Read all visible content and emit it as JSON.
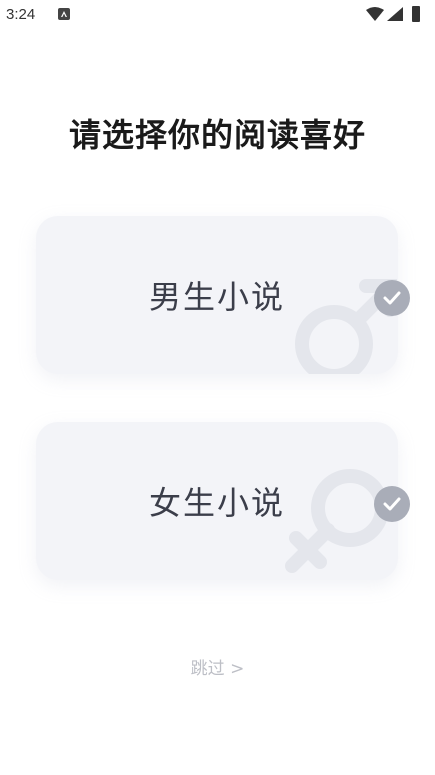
{
  "status_bar": {
    "time": "3:24",
    "icons": [
      "notification-a-icon",
      "wifi-icon",
      "signal-icon",
      "battery-icon"
    ]
  },
  "title": "请选择你的阅读喜好",
  "options": [
    {
      "label": "男生小说",
      "icon": "male-symbol-icon",
      "selected_icon": "check-icon"
    },
    {
      "label": "女生小说",
      "icon": "female-symbol-icon",
      "selected_icon": "check-icon"
    }
  ],
  "skip": "跳过 >",
  "colors": {
    "card_bg": "#f3f4f8",
    "check_bg": "#a9adb8",
    "skip_text": "#bdbfc6"
  }
}
